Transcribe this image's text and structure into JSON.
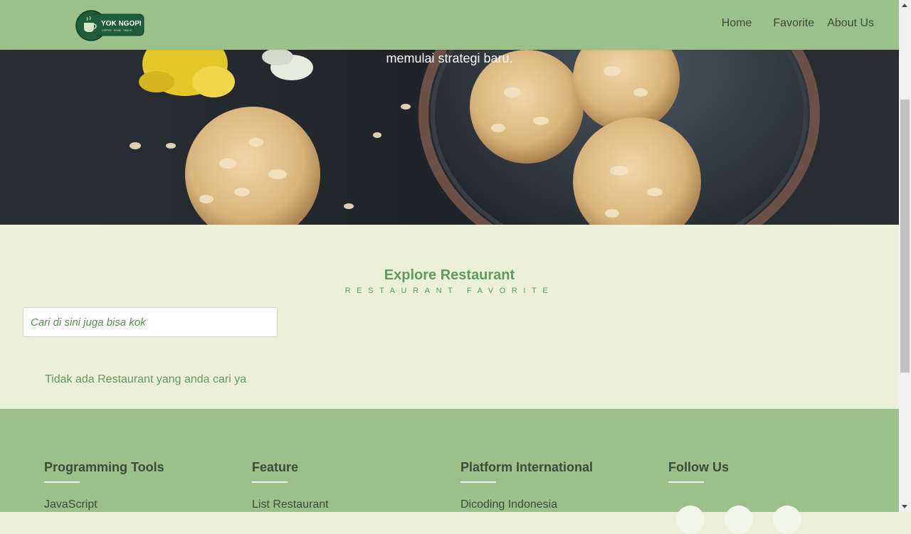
{
  "header": {
    "logo_text": "YOK NGOPI",
    "logo_tagline": "COFFEE · DRINK · SNACK",
    "nav": [
      "Home",
      "Favorite",
      "About Us"
    ]
  },
  "hero": {
    "text": "memulai strategi baru."
  },
  "explore": {
    "title": "Explore Restaurant",
    "subtitle": "RESTAURANT FAVORITE",
    "search_placeholder": "Cari di sini juga bisa kok",
    "empty_message": "Tidak ada Restaurant yang anda cari ya"
  },
  "footer": {
    "columns": [
      {
        "heading": "Programming Tools",
        "first_link": "JavaScript"
      },
      {
        "heading": "Feature",
        "first_link": "List Restaurant"
      },
      {
        "heading": "Platform International",
        "first_link": "Dicoding Indonesia"
      },
      {
        "heading": "Follow Us"
      }
    ]
  },
  "colors": {
    "header_bg": "#9bc08a",
    "page_bg": "#ecf0d8",
    "accent_green": "#5f9a61",
    "text_dark": "#3d4a37"
  }
}
